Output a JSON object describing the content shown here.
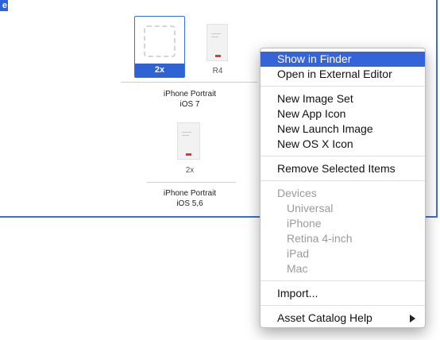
{
  "pane": {
    "corner_badge": "e"
  },
  "slots": {
    "ios7_2x_label": "2x",
    "ios7_r4_label": "R4",
    "ios56_2x_label": "2x"
  },
  "groups": {
    "ios7_line1": "iPhone Portrait",
    "ios7_line2": "iOS 7",
    "ios56_line1": "iPhone Portrait",
    "ios56_line2": "iOS 5,6"
  },
  "menu": {
    "show_in_finder": "Show in Finder",
    "open_external": "Open in External Editor",
    "new_image_set": "New Image Set",
    "new_app_icon": "New App Icon",
    "new_launch_image": "New Launch Image",
    "new_osx_icon": "New OS X Icon",
    "remove_selected": "Remove Selected Items",
    "devices_header": "Devices",
    "devices": [
      "Universal",
      "iPhone",
      "Retina 4-inch",
      "iPad",
      "Mac"
    ],
    "import": "Import...",
    "help": "Asset Catalog Help",
    "submenu_icon": "triangle-right-icon"
  },
  "colors": {
    "accent": "#3563d8",
    "pane_border": "#3b6fd4",
    "disabled_text": "#9a9a9a"
  }
}
